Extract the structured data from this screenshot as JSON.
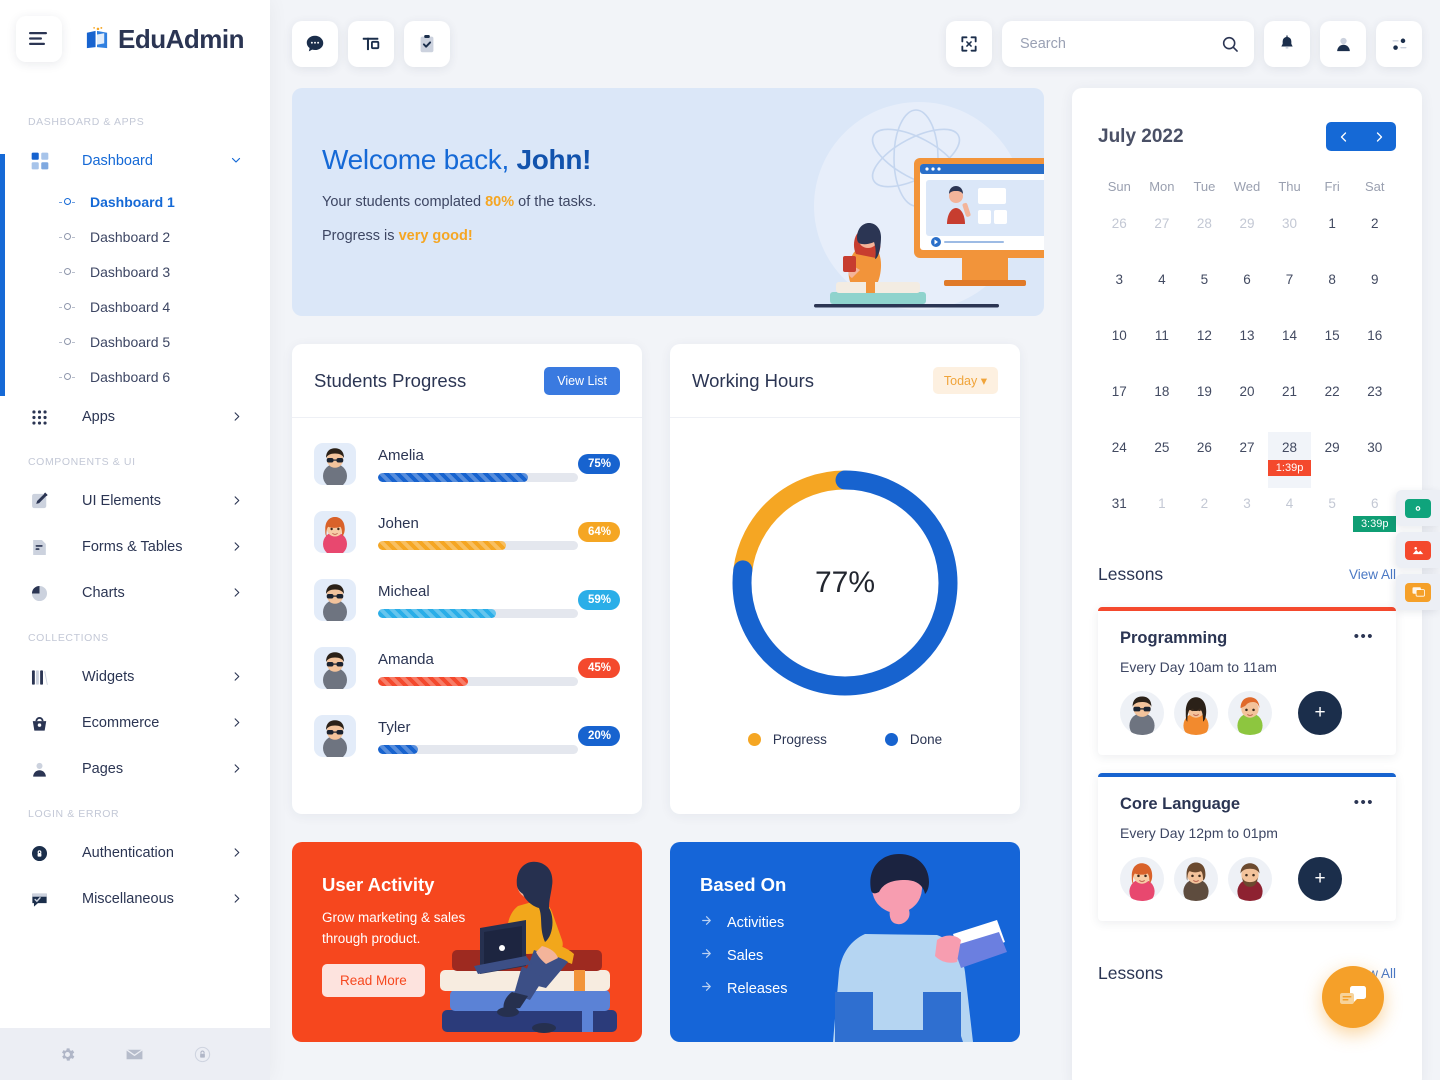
{
  "brand": {
    "name_prefix": "Edu",
    "name_suffix": "Admin",
    "logo_icon": "book-logo-icon",
    "hamburger_icon": "hamburger-menu-icon"
  },
  "sidebar": {
    "sections": [
      {
        "title": "DASHBOARD & APPS",
        "items": [
          {
            "label": "Dashboard",
            "icon": "grid-squares-icon",
            "caret": "chevron-down-icon",
            "active": true,
            "children": [
              {
                "label": "Dashboard 1",
                "active": true
              },
              {
                "label": "Dashboard 2",
                "active": false
              },
              {
                "label": "Dashboard 3",
                "active": false
              },
              {
                "label": "Dashboard 4",
                "active": false
              },
              {
                "label": "Dashboard 5",
                "active": false
              },
              {
                "label": "Dashboard 6",
                "active": false
              }
            ]
          },
          {
            "label": "Apps",
            "icon": "apps-dots-icon",
            "caret": "chevron-right-icon",
            "active": false,
            "children": []
          }
        ]
      },
      {
        "title": "COMPONENTS & UI",
        "items": [
          {
            "label": "UI Elements",
            "icon": "pencil-square-icon",
            "caret": "chevron-right-icon",
            "active": false,
            "children": []
          },
          {
            "label": "Forms & Tables",
            "icon": "document-icon",
            "caret": "chevron-right-icon",
            "active": false,
            "children": []
          },
          {
            "label": "Charts",
            "icon": "pie-chart-icon",
            "caret": "chevron-right-icon",
            "active": false,
            "children": []
          }
        ]
      },
      {
        "title": "COLLECTIONS",
        "items": [
          {
            "label": "Widgets",
            "icon": "books-icon",
            "caret": "chevron-right-icon",
            "active": false,
            "children": []
          },
          {
            "label": "Ecommerce",
            "icon": "basket-icon",
            "caret": "chevron-right-icon",
            "active": false,
            "children": []
          },
          {
            "label": "Pages",
            "icon": "user-icon",
            "caret": "chevron-right-icon",
            "active": false,
            "children": []
          }
        ]
      },
      {
        "title": "LOGIN & ERROR",
        "items": [
          {
            "label": "Authentication",
            "icon": "lock-circle-icon",
            "caret": "chevron-right-icon",
            "active": false,
            "children": []
          },
          {
            "label": "Miscellaneous",
            "icon": "chat-check-icon",
            "caret": "chevron-right-icon",
            "active": false,
            "children": []
          }
        ]
      }
    ],
    "footer_icons": [
      "gear-icon",
      "envelope-icon",
      "lock-icon"
    ]
  },
  "topbar": {
    "left_buttons": [
      {
        "icon": "chat-bubble-icon"
      },
      {
        "icon": "layout-icon"
      },
      {
        "icon": "clipboard-check-icon"
      }
    ],
    "fullscreen_icon": "fullscreen-expand-icon",
    "search": {
      "placeholder": "Search",
      "value": "",
      "icon": "search-icon"
    },
    "right_buttons": [
      {
        "icon": "bell-icon"
      },
      {
        "icon": "user-profile-icon"
      },
      {
        "icon": "sliders-settings-icon"
      }
    ]
  },
  "welcome": {
    "greeting_prefix": "Welcome back, ",
    "greeting_name": "John!",
    "line1_a": "Your students complated ",
    "line1_b": "80%",
    "line1_c": " of the tasks.",
    "line2_a": "Progress is ",
    "line2_b": "very good!"
  },
  "students_progress": {
    "title": "Students Progress",
    "action_label": "View List",
    "rows": [
      {
        "name": "Amelia",
        "percent": "75%",
        "value": 75,
        "color": "#1763cf",
        "avatar": "man-sunglasses-avatar"
      },
      {
        "name": "Johen",
        "percent": "64%",
        "value": 64,
        "color": "#f5a623",
        "avatar": "woman-redhair-avatar"
      },
      {
        "name": "Micheal",
        "percent": "59%",
        "value": 59,
        "color": "#2aaee8",
        "avatar": "man-sunglasses-avatar"
      },
      {
        "name": "Amanda",
        "percent": "45%",
        "value": 45,
        "color": "#f4492d",
        "avatar": "man-sunglasses-avatar"
      },
      {
        "name": "Tyler",
        "percent": "20%",
        "value": 20,
        "color": "#1763cf",
        "avatar": "man-sunglasses-avatar"
      }
    ]
  },
  "working_hours": {
    "title": "Working Hours",
    "filter_label": "Today",
    "center_label": "77%",
    "legend": [
      {
        "label": "Progress",
        "color": "#f5a623"
      },
      {
        "label": "Done",
        "color": "#1763cf"
      }
    ]
  },
  "chart_data": {
    "type": "pie",
    "title": "Working Hours",
    "labels": [
      "Done",
      "Progress"
    ],
    "values": [
      77,
      23
    ],
    "colors": [
      "#1763cf",
      "#f5a623"
    ],
    "center_label": "77%",
    "legend_position": "bottom",
    "donut": true
  },
  "promo_user_activity": {
    "title": "User Activity",
    "body": "Grow marketing & sales through product.",
    "button_label": "Read More",
    "bg": "#f6471e"
  },
  "promo_based_on": {
    "title": "Based On",
    "bg": "#1565d8",
    "items": [
      "Activities",
      "Sales",
      "Releases"
    ]
  },
  "calendar": {
    "month_label": "July 2022",
    "prev_icon": "chevron-left-icon",
    "next_icon": "chevron-right-icon",
    "day_names": [
      "Sun",
      "Mon",
      "Tue",
      "Wed",
      "Thu",
      "Fri",
      "Sat"
    ],
    "weeks": [
      [
        {
          "d": "26",
          "muted": true
        },
        {
          "d": "27",
          "muted": true
        },
        {
          "d": "28",
          "muted": true
        },
        {
          "d": "29",
          "muted": true
        },
        {
          "d": "30",
          "muted": true
        },
        {
          "d": "1",
          "muted": false
        },
        {
          "d": "2",
          "muted": false
        }
      ],
      [
        {
          "d": "3",
          "muted": false
        },
        {
          "d": "4",
          "muted": false
        },
        {
          "d": "5",
          "muted": false
        },
        {
          "d": "6",
          "muted": false
        },
        {
          "d": "7",
          "muted": false
        },
        {
          "d": "8",
          "muted": false
        },
        {
          "d": "9",
          "muted": false
        }
      ],
      [
        {
          "d": "10",
          "muted": false
        },
        {
          "d": "11",
          "muted": false
        },
        {
          "d": "12",
          "muted": false
        },
        {
          "d": "13",
          "muted": false
        },
        {
          "d": "14",
          "muted": false
        },
        {
          "d": "15",
          "muted": false
        },
        {
          "d": "16",
          "muted": false
        }
      ],
      [
        {
          "d": "17",
          "muted": false
        },
        {
          "d": "18",
          "muted": false
        },
        {
          "d": "19",
          "muted": false
        },
        {
          "d": "20",
          "muted": false
        },
        {
          "d": "21",
          "muted": false
        },
        {
          "d": "22",
          "muted": false
        },
        {
          "d": "23",
          "muted": false
        }
      ],
      [
        {
          "d": "24",
          "muted": false
        },
        {
          "d": "25",
          "muted": false
        },
        {
          "d": "26",
          "muted": false
        },
        {
          "d": "27",
          "muted": false
        },
        {
          "d": "28",
          "muted": false,
          "today": true,
          "event": {
            "label": "1:39p",
            "color": "#f4492d"
          }
        },
        {
          "d": "29",
          "muted": false
        },
        {
          "d": "30",
          "muted": false
        }
      ],
      [
        {
          "d": "31",
          "muted": false
        },
        {
          "d": "1",
          "muted": true
        },
        {
          "d": "2",
          "muted": true
        },
        {
          "d": "3",
          "muted": true
        },
        {
          "d": "4",
          "muted": true
        },
        {
          "d": "5",
          "muted": true
        },
        {
          "d": "6",
          "muted": true,
          "event": {
            "label": "3:39p",
            "color": "#0f9e74"
          }
        }
      ]
    ]
  },
  "lessons": {
    "title": "Lessons",
    "view_all_label": "View All",
    "cards": [
      {
        "name": "Programming",
        "time": "Every Day 10am to 11am",
        "accent": "#f4492d",
        "menu_icon": "more-horizontal-icon",
        "avatars": [
          "man-sunglasses-avatar",
          "woman-dark-hair-avatar",
          "boy-green-shirt-avatar"
        ],
        "add_label": "+"
      },
      {
        "name": "Core Language",
        "time": "Every Day 12pm to 01pm",
        "accent": "#1763cf",
        "menu_icon": "more-horizontal-icon",
        "avatars": [
          "woman-redhair-avatar",
          "woman-brown-hair-avatar",
          "man-beard-avatar"
        ],
        "add_label": "+"
      }
    ]
  },
  "lessons_second": {
    "title": "Lessons",
    "view_all_label": "View All"
  },
  "float_widgets": [
    {
      "icon": "camera-icon",
      "color": "#0fa47c"
    },
    {
      "icon": "image-icon",
      "color": "#f4492d"
    },
    {
      "icon": "chat-widget-icon",
      "color": "#f5a029"
    }
  ],
  "fab": {
    "icon": "chat-bubbles-icon",
    "color": "#f5a029"
  }
}
